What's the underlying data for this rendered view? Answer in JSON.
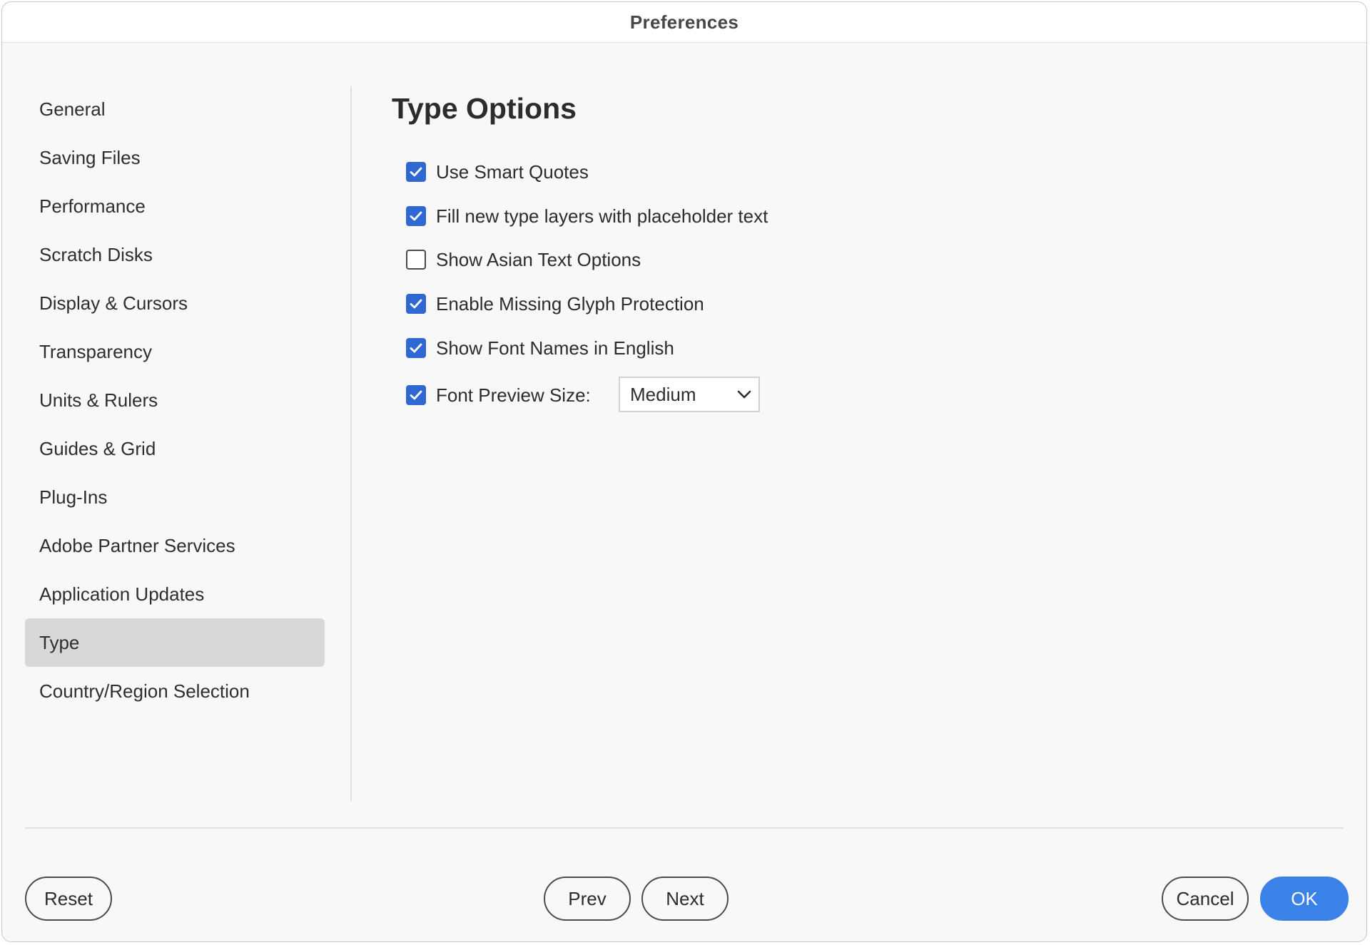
{
  "window": {
    "title": "Preferences"
  },
  "sidebar": {
    "items": [
      {
        "label": "General",
        "selected": false
      },
      {
        "label": "Saving Files",
        "selected": false
      },
      {
        "label": "Performance",
        "selected": false
      },
      {
        "label": "Scratch Disks",
        "selected": false
      },
      {
        "label": "Display & Cursors",
        "selected": false
      },
      {
        "label": "Transparency",
        "selected": false
      },
      {
        "label": "Units & Rulers",
        "selected": false
      },
      {
        "label": "Guides & Grid",
        "selected": false
      },
      {
        "label": "Plug-Ins",
        "selected": false
      },
      {
        "label": "Adobe Partner Services",
        "selected": false
      },
      {
        "label": "Application Updates",
        "selected": false
      },
      {
        "label": "Type",
        "selected": true
      },
      {
        "label": "Country/Region Selection",
        "selected": false
      }
    ]
  },
  "main": {
    "section_title": "Type Options",
    "options": [
      {
        "label": "Use Smart Quotes",
        "checked": true
      },
      {
        "label": "Fill new type layers with placeholder text",
        "checked": true
      },
      {
        "label": "Show Asian Text Options",
        "checked": false
      },
      {
        "label": "Enable Missing Glyph Protection",
        "checked": true
      },
      {
        "label": "Show Font Names in English",
        "checked": true
      },
      {
        "label": "Font Preview Size:",
        "checked": true
      }
    ],
    "font_preview_size": {
      "value": "Medium"
    }
  },
  "footer": {
    "reset_label": "Reset",
    "prev_label": "Prev",
    "next_label": "Next",
    "cancel_label": "Cancel",
    "ok_label": "OK"
  },
  "colors": {
    "accent": "#2f68d2",
    "primary_button": "#3b82e8",
    "selected_nav": "#d8d8d8"
  },
  "icons": {
    "checkbox_checked": "checkmark-icon",
    "dropdown": "chevron-down-icon"
  }
}
